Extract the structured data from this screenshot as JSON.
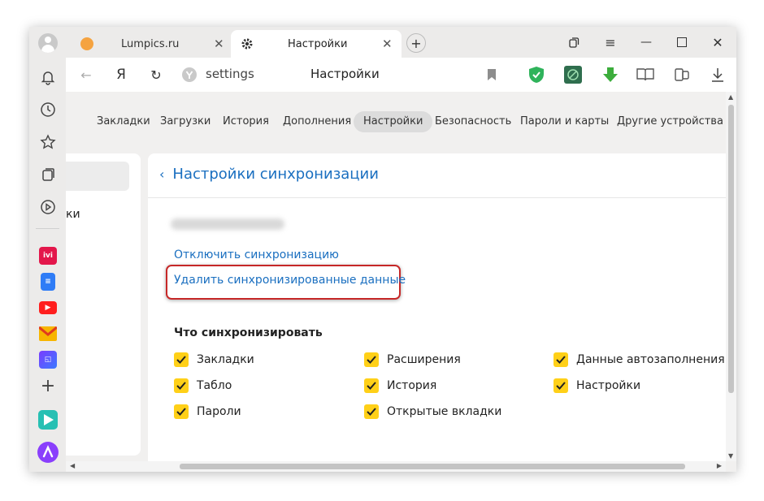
{
  "tabs": [
    {
      "title": "Lumpics.ru",
      "favicon": "orange-circle-icon"
    },
    {
      "title": "Настройки",
      "favicon": "gear-icon"
    }
  ],
  "address": {
    "text": "settings",
    "page_title": "Настройки",
    "yandex_glyph": "Я"
  },
  "nav": {
    "items": [
      "Закладки",
      "Загрузки",
      "История",
      "Дополнения",
      "Настройки",
      "Безопасность",
      "Пароли и карты",
      "Другие устройства"
    ],
    "active_index": 4
  },
  "sidebar": {
    "partial_text": "ки"
  },
  "sync": {
    "header": "Настройки синхронизации",
    "disable_link": "Отключить синхронизацию",
    "delete_link": "Удалить синхронизированные данные",
    "section_title": "Что синхронизировать",
    "options": [
      {
        "label": "Закладки",
        "checked": true
      },
      {
        "label": "Расширения",
        "checked": true
      },
      {
        "label": "Данные автозаполнения",
        "checked": true
      },
      {
        "label": "Табло",
        "checked": true
      },
      {
        "label": "История",
        "checked": true
      },
      {
        "label": "Настройки",
        "checked": true
      },
      {
        "label": "Пароли",
        "checked": true
      },
      {
        "label": "Открытые вкладки",
        "checked": true
      }
    ]
  },
  "colors": {
    "accent_link": "#1a6fc0",
    "checkbox": "#ffd018",
    "highlight_border": "#c62828"
  }
}
